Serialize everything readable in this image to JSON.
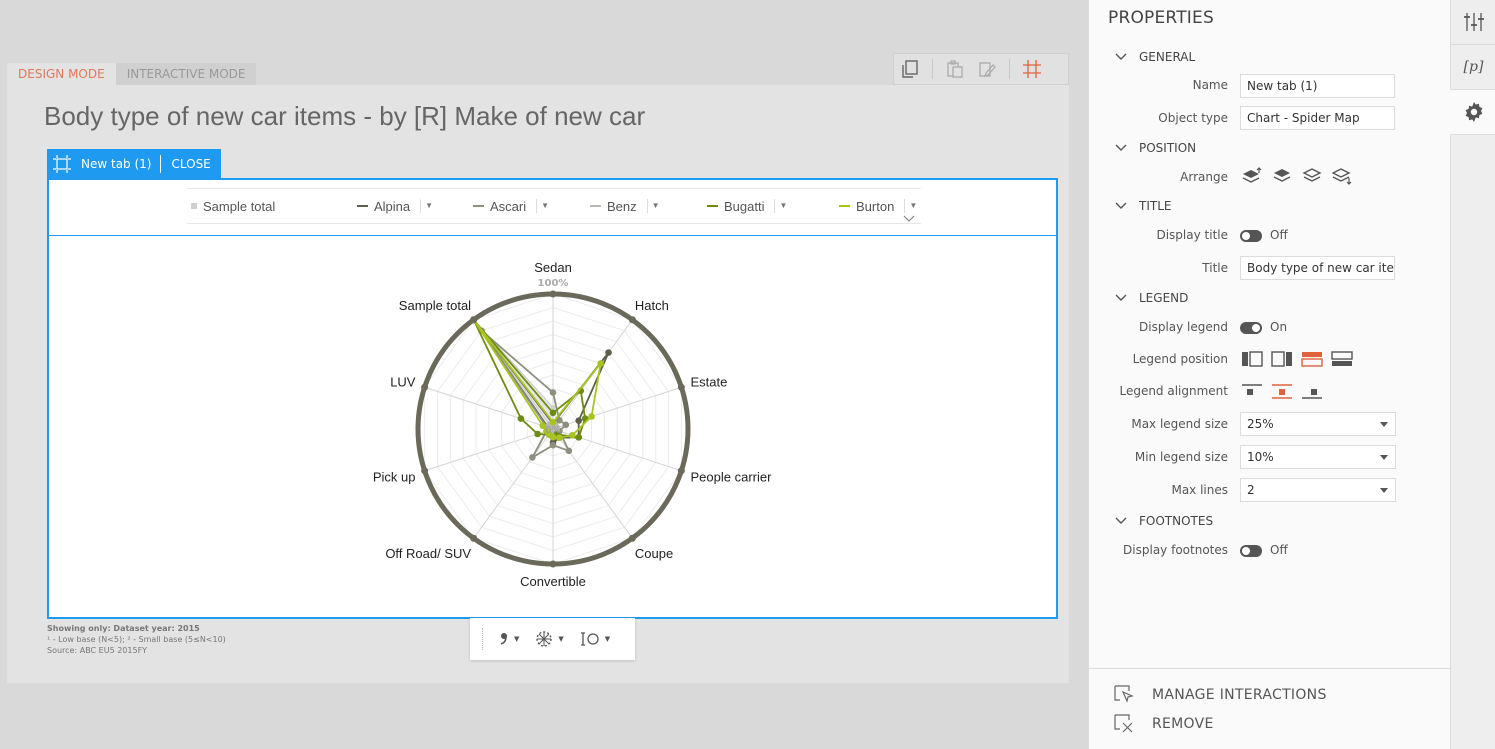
{
  "mode_tabs": [
    {
      "label": "DESIGN MODE",
      "active": true
    },
    {
      "label": "INTERACTIVE MODE",
      "active": false
    }
  ],
  "page_title": "Body type of new car items - by [R] Make of new car",
  "tab": {
    "name": "New tab (1)",
    "close_label": "CLOSE"
  },
  "legend": [
    {
      "label": "Sample total",
      "color": "#cfcfcf",
      "swatch": "square",
      "dropdown": false
    },
    {
      "label": "Alpina",
      "color": "#5e5e4a",
      "swatch": "line",
      "dropdown": true
    },
    {
      "label": "Ascari",
      "color": "#8f8f80",
      "swatch": "line",
      "dropdown": true
    },
    {
      "label": "Benz",
      "color": "#b8b8b0",
      "swatch": "line",
      "dropdown": true
    },
    {
      "label": "Bugatti",
      "color": "#6f8c12",
      "swatch": "line",
      "dropdown": true
    },
    {
      "label": "Burton",
      "color": "#a8c41e",
      "swatch": "line",
      "dropdown": true
    }
  ],
  "chart_data": {
    "type": "radar",
    "axes": [
      "Sedan",
      "Hatch",
      "Estate",
      "People carrier",
      "Coupe",
      "Convertible",
      "Off Road/ SUV",
      "Pick up",
      "LUV",
      "Sample total"
    ],
    "scale_labels": {
      "max": "100%",
      "min": "0%"
    },
    "series": [
      {
        "name": "Sample total",
        "color": "#cfcfcf",
        "values": [
          16,
          0,
          10,
          0,
          0,
          0,
          0,
          0,
          5,
          100
        ]
      },
      {
        "name": "Alpina",
        "color": "#5e5e4a",
        "values": [
          4,
          70,
          20,
          20,
          8,
          10,
          5,
          3,
          4,
          100
        ]
      },
      {
        "name": "Ascari",
        "color": "#8f8f80",
        "values": [
          27,
          8,
          10,
          5,
          20,
          12,
          26,
          5,
          5,
          90
        ]
      },
      {
        "name": "Benz",
        "color": "#b8b8b0",
        "values": [
          4,
          3,
          3,
          3,
          4,
          4,
          3,
          3,
          4,
          4
        ]
      },
      {
        "name": "Bugatti",
        "color": "#6f8c12",
        "values": [
          12,
          35,
          25,
          20,
          5,
          6,
          5,
          12,
          25,
          100
        ]
      },
      {
        "name": "Burton",
        "color": "#a8c41e",
        "values": [
          5,
          60,
          30,
          15,
          8,
          6,
          5,
          5,
          8,
          100
        ]
      }
    ]
  },
  "footnotes": {
    "line1": "Showing only: Dataset year: 2015",
    "line2": "¹ - Low base (N<5);   ² - Small base (5≤N<10)",
    "line3": "Source: ABC EU5 2015FY"
  },
  "properties": {
    "title": "PROPERTIES",
    "sections": {
      "general": "GENERAL",
      "position": "POSITION",
      "title": "TITLE",
      "legend": "LEGEND",
      "footnotes": "FOOTNOTES"
    },
    "labels": {
      "name": "Name",
      "object_type": "Object type",
      "arrange": "Arrange",
      "display_title": "Display title",
      "title": "Title",
      "display_legend": "Display legend",
      "legend_position": "Legend position",
      "legend_alignment": "Legend alignment",
      "max_legend_size": "Max legend size",
      "min_legend_size": "Min legend size",
      "max_lines": "Max lines",
      "display_footnotes": "Display footnotes"
    },
    "values": {
      "name": "New tab (1)",
      "object_type": "Chart - Spider Map",
      "display_title": "Off",
      "title": "Body type of new car items - by [R] Make of new car",
      "display_legend": "On",
      "max_legend_size": "25%",
      "min_legend_size": "10%",
      "max_lines": "2",
      "display_footnotes": "Off"
    },
    "actions": {
      "manage_interactions": "MANAGE INTERACTIONS",
      "remove": "REMOVE"
    }
  },
  "rail": {
    "variables_label": "[p]"
  },
  "colors": {
    "accent": "#1e9bf0",
    "design_mode": "#e0785a",
    "active_option": "#e0623a"
  }
}
